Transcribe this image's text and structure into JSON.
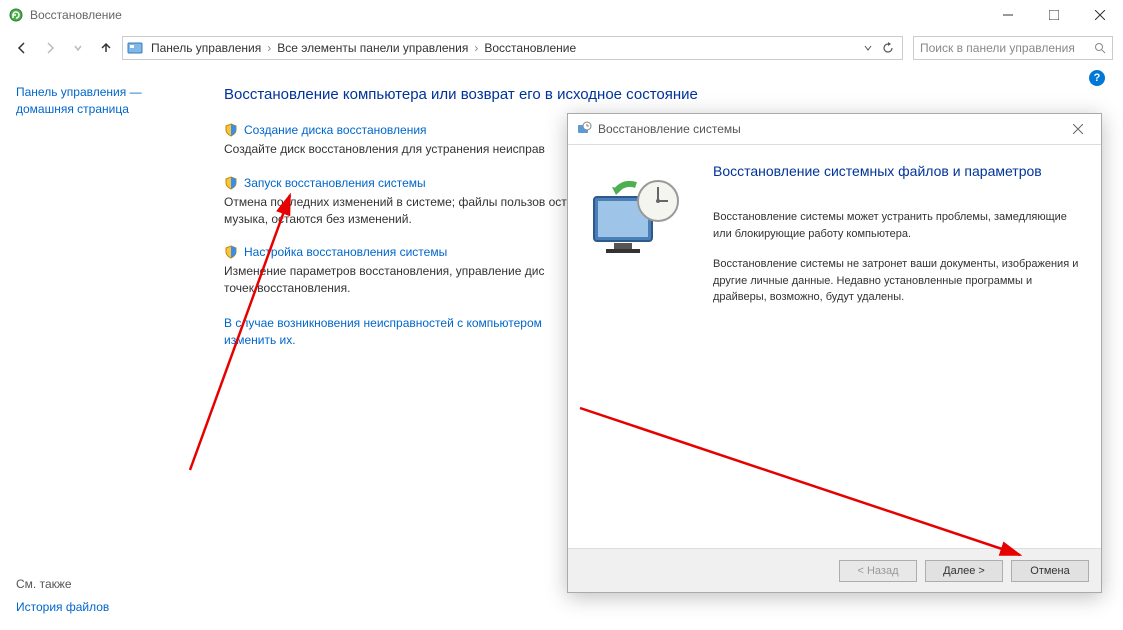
{
  "window": {
    "title": "Восстановление"
  },
  "nav": {
    "breadcrumbs": [
      "Панель управления",
      "Все элементы панели управления",
      "Восстановление"
    ],
    "search_placeholder": "Поиск в панели управления"
  },
  "sidebar": {
    "home_link_line1": "Панель управления —",
    "home_link_line2": "домашняя страница",
    "see_also_heading": "См. также",
    "see_also_link": "История файлов"
  },
  "main": {
    "heading": "Восстановление компьютера или возврат его в исходное состояние",
    "options": [
      {
        "link": "Создание диска восстановления",
        "desc": "Создайте диск восстановления для устранения неисправ"
      },
      {
        "link": "Запуск восстановления системы",
        "desc": "Отмена последних изменений в системе; файлы пользов                            остаются без изменений.\nмузыка, остаются без изменений."
      },
      {
        "link": "Настройка восстановления системы",
        "desc": "Изменение параметров восстановления, управление дис\nточек восстановления."
      }
    ],
    "troubleshoot": "В случае возникновения неисправностей с компьютером\nизменить их."
  },
  "dialog": {
    "title": "Восстановление системы",
    "heading": "Восстановление системных файлов и параметров",
    "para1": "Восстановление системы может устранить проблемы, замедляющие или блокирующие работу компьютера.",
    "para2": "Восстановление системы не затронет ваши документы, изображения и другие личные данные. Недавно установленные программы и драйверы, возможно, будут удалены.",
    "btn_back": "< Назад",
    "btn_next": "Далее >",
    "btn_cancel": "Отмена"
  },
  "help": "?"
}
